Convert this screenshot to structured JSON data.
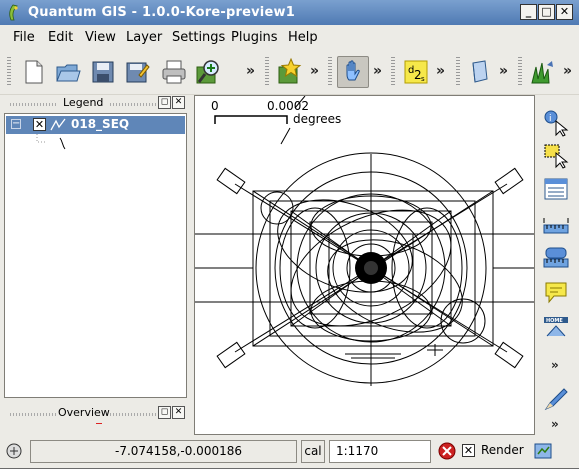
{
  "window": {
    "title": "Quantum GIS - 1.0.0-Kore-preview1",
    "controls": {
      "minimize": "_",
      "maximize": "□",
      "close": "✕"
    }
  },
  "menubar": {
    "items": [
      {
        "label": "File"
      },
      {
        "label": "Edit"
      },
      {
        "label": "View"
      },
      {
        "label": "Layer"
      },
      {
        "label": "Settings"
      },
      {
        "label": "Plugins"
      },
      {
        "label": "Help"
      }
    ]
  },
  "toolbar": {
    "more": "»",
    "icons": [
      "new-project-icon",
      "open-project-icon",
      "save-project-icon",
      "save-as-icon",
      "print-icon",
      "zoom-in-icon",
      "new-bookmark-icon",
      "pan-hand-icon",
      "digitize-icon",
      "help-book-icon",
      "grass-icon"
    ]
  },
  "legend": {
    "title": "Legend",
    "float_btn": "◻",
    "close_btn": "✕",
    "layer": {
      "expander": "−",
      "checked": "✕",
      "name": "018_SEQ"
    }
  },
  "overview": {
    "title": "Overview",
    "float_btn": "◻",
    "close_btn": "✕"
  },
  "map": {
    "scalebar": {
      "left_label": "0",
      "right_label": "0.0002",
      "unit": "degrees"
    }
  },
  "statusbar": {
    "coordinates": "-7.074158,-0.000186",
    "scale_label": "cal",
    "scale_value": "1:1170",
    "render_label": "Render",
    "render_checked": "✕"
  },
  "colors": {
    "title_bar": "#5b84bb",
    "selection": "#5f86b8",
    "stop_red": "#cc2222"
  }
}
